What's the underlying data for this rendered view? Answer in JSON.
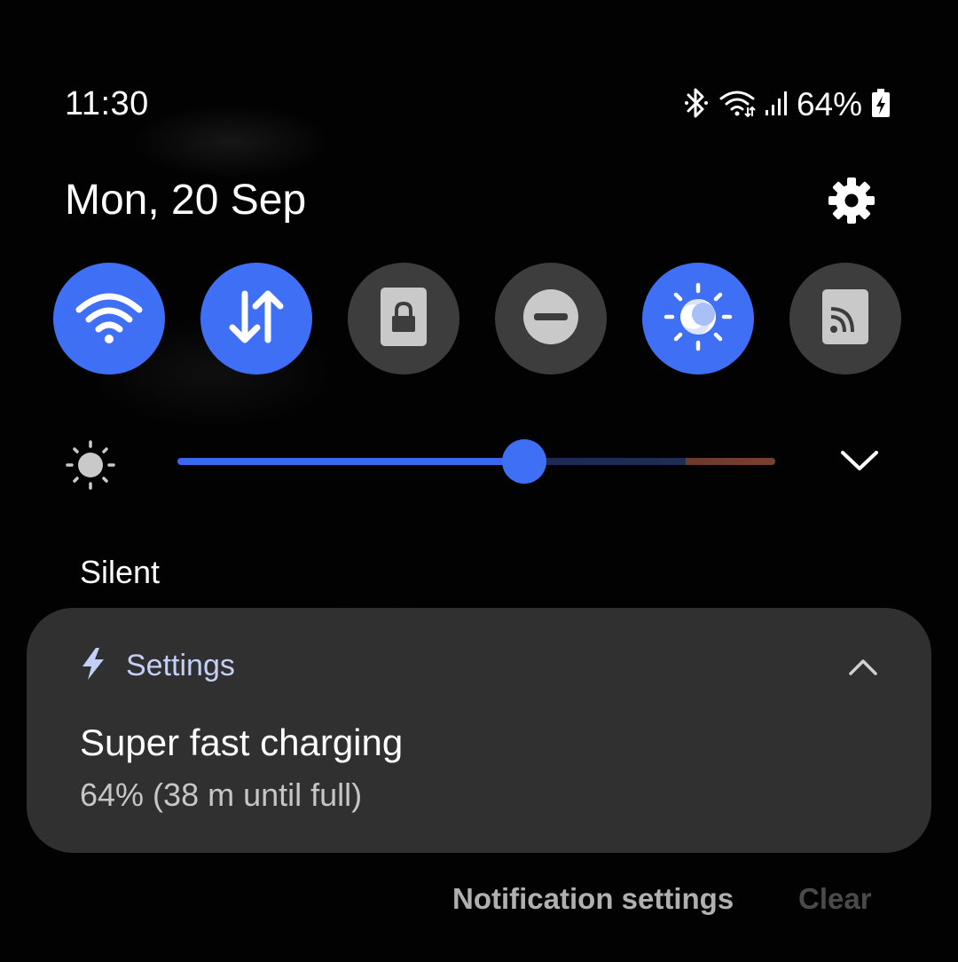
{
  "status_bar": {
    "time": "11:30",
    "battery_percent": "64%",
    "icons": [
      "bluetooth-icon",
      "wifi-icon",
      "signal-icon",
      "battery-charging-icon"
    ]
  },
  "header": {
    "date": "Mon, 20 Sep",
    "settings_icon": "gear-icon"
  },
  "quick_tiles": [
    {
      "name": "wifi",
      "icon": "wifi-icon",
      "state": "on"
    },
    {
      "name": "mobile-data",
      "icon": "data-arrows-icon",
      "state": "on"
    },
    {
      "name": "lock",
      "icon": "lock-icon",
      "state": "off"
    },
    {
      "name": "do-not-disturb",
      "icon": "minus-circle-icon",
      "state": "off"
    },
    {
      "name": "eye-comfort",
      "icon": "sun-moon-icon",
      "state": "on"
    },
    {
      "name": "cast",
      "icon": "cast-icon",
      "state": "off"
    }
  ],
  "brightness": {
    "icon": "brightness-icon",
    "level": 0.58,
    "expand_icon": "chevron-down-icon"
  },
  "section_title": "Silent",
  "notification": {
    "app_icon": "lightning-icon",
    "app_name": "Settings",
    "collapse_icon": "chevron-up-icon",
    "title": "Super fast charging",
    "body": "64% (38 m until full)"
  },
  "footer": {
    "notification_settings": "Notification settings",
    "clear": "Clear"
  },
  "colors": {
    "accent": "#3e6ff5",
    "tile_off": "#3d3d3d",
    "card_bg": "#303030",
    "app_name": "#c3cff5"
  }
}
